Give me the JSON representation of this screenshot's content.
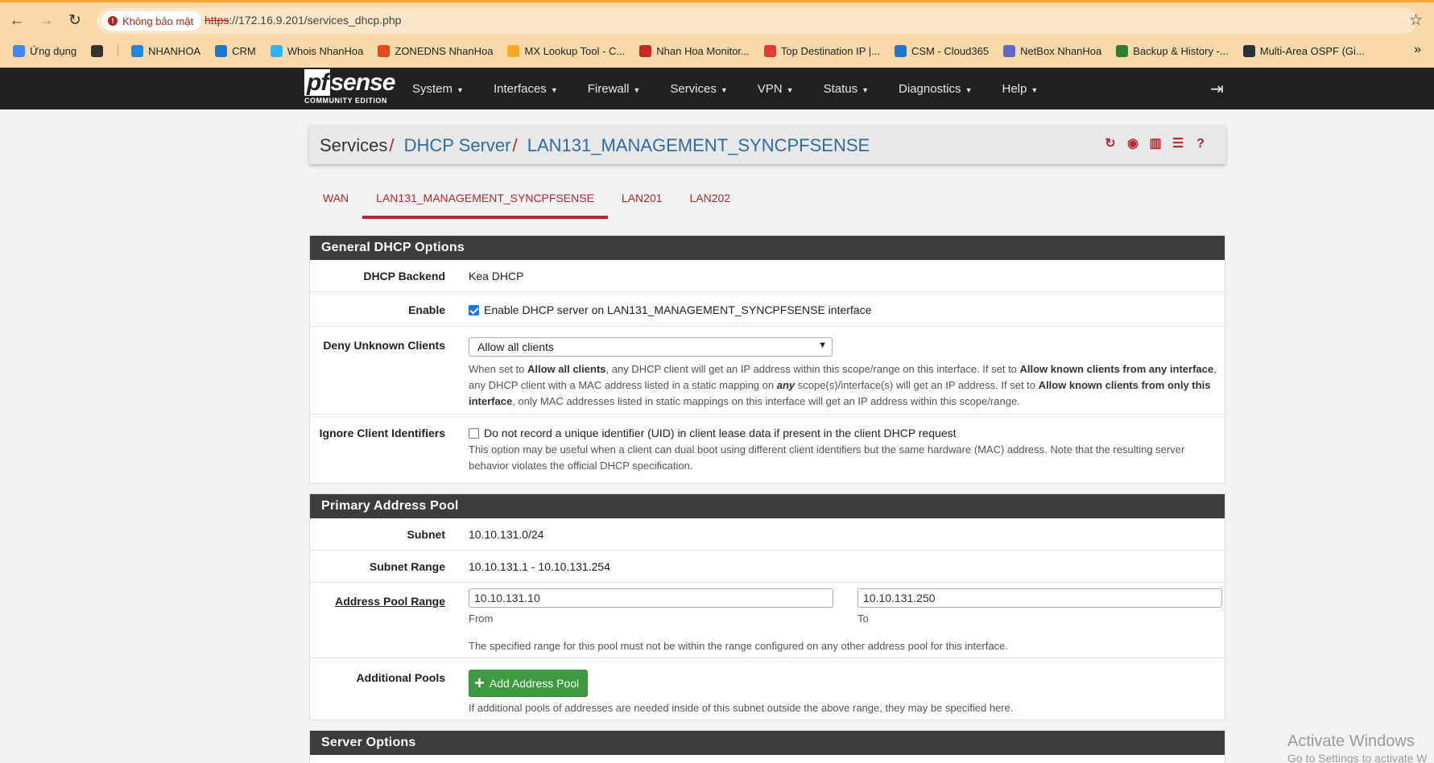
{
  "browser": {
    "security_label": "Không bảo mật",
    "url_scheme": "https",
    "url_rest": "://172.16.9.201/services_dhcp.php",
    "bookmarks": [
      {
        "label": "Ứng dụng",
        "color": "#4285f4"
      },
      {
        "label": "",
        "color": "#333333"
      },
      {
        "label": "NHANHOA",
        "color": "#1e88e5"
      },
      {
        "label": "CRM",
        "color": "#1976d2"
      },
      {
        "label": "Whois NhanHoa",
        "color": "#29b6f6"
      },
      {
        "label": "ZONEDNS NhanHoa",
        "color": "#e64a19"
      },
      {
        "label": "MX Lookup Tool - C...",
        "color": "#f9a825"
      },
      {
        "label": "Nhan Hoa Monitor...",
        "color": "#c62828"
      },
      {
        "label": "Top Destination IP |...",
        "color": "#e53935"
      },
      {
        "label": "CSM - Cloud365",
        "color": "#1976d2"
      },
      {
        "label": "NetBox NhanHoa",
        "color": "#5c6bc0"
      },
      {
        "label": "Backup & History -...",
        "color": "#2e7d32"
      },
      {
        "label": "Multi-Area OSPF (Gi...",
        "color": "#263238"
      }
    ]
  },
  "navbar": {
    "logo_text": "sense",
    "logo_prefix": "pf",
    "logo_sub": "COMMUNITY EDITION",
    "menu": [
      "System",
      "Interfaces",
      "Firewall",
      "Services",
      "VPN",
      "Status",
      "Diagnostics",
      "Help"
    ]
  },
  "breadcrumb": {
    "root": "Services",
    "level2": "DHCP Server",
    "level3": "LAN131_MANAGEMENT_SYNCPFSENSE"
  },
  "tabs": [
    "WAN",
    "LAN131_MANAGEMENT_SYNCPFSENSE",
    "LAN201",
    "LAN202"
  ],
  "active_tab": "LAN131_MANAGEMENT_SYNCPFSENSE",
  "general": {
    "title": "General DHCP Options",
    "backend_label": "DHCP Backend",
    "backend_value": "Kea DHCP",
    "enable_label": "Enable",
    "enable_text": "Enable DHCP server on LAN131_MANAGEMENT_SYNCPFSENSE interface",
    "enable_checked": true,
    "deny_label": "Deny Unknown Clients",
    "deny_value": "Allow all clients",
    "deny_help_1": "When set to ",
    "deny_help_b1": "Allow all clients",
    "deny_help_2": ", any DHCP client will get an IP address within this scope/range on this interface. If set to ",
    "deny_help_b2": "Allow known clients from any interface",
    "deny_help_3": ", any DHCP client with a MAC address listed in a static mapping on ",
    "deny_help_b3": "any",
    "deny_help_4": " scope(s)/interface(s) will get an IP address. If set to ",
    "deny_help_b4": "Allow known clients from only this interface",
    "deny_help_5": ", only MAC addresses listed in static mappings on this interface will get an IP address within this scope/range.",
    "ignore_label": "Ignore Client Identifiers",
    "ignore_text": "Do not record a unique identifier (UID) in client lease data if present in the client DHCP request",
    "ignore_checked": false,
    "ignore_help": "This option may be useful when a client can dual boot using different client identifiers but the same hardware (MAC) address. Note that the resulting server behavior violates the official DHCP specification."
  },
  "pool": {
    "title": "Primary Address Pool",
    "subnet_label": "Subnet",
    "subnet_value": "10.10.131.0/24",
    "range_label": "Subnet Range",
    "range_value": "10.10.131.1 - 10.10.131.254",
    "pool_label": "Address Pool Range",
    "from_value": "10.10.131.10",
    "from_caption": "From",
    "to_value": "10.10.131.250",
    "to_caption": "To",
    "pool_help": "The specified range for this pool must not be within the range configured on any other address pool for this interface.",
    "additional_label": "Additional Pools",
    "add_button": "Add Address Pool",
    "additional_help": "If additional pools of addresses are needed inside of this subnet outside the above range, they may be specified here."
  },
  "server": {
    "title": "Server Options"
  },
  "watermark": {
    "line1": "Activate Windows",
    "line2": "Go to Settings to activate W"
  },
  "colors": {
    "brand_red": "#b5272d",
    "link_blue": "#2d6ca2",
    "panel_head": "#3c3c3c",
    "button_green": "#3e9a3e"
  }
}
